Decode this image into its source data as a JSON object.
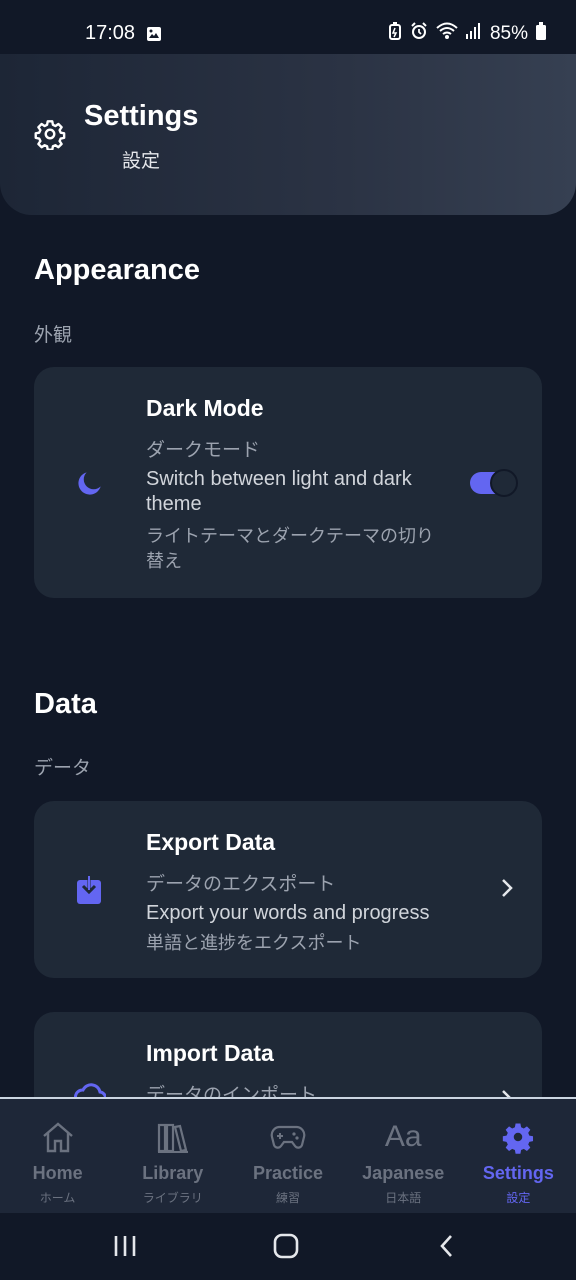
{
  "status_bar": {
    "time": "17:08",
    "battery": "85%"
  },
  "header": {
    "title": "Settings",
    "subtitle": "設定",
    "icon": "gear-icon"
  },
  "sections": {
    "appearance": {
      "title": "Appearance",
      "subtitle": "外観"
    },
    "data": {
      "title": "Data",
      "subtitle": "データ"
    }
  },
  "dark_mode": {
    "icon": "moon-icon",
    "title": "Dark Mode",
    "title_jp": "ダークモード",
    "desc": "Switch between light and dark theme",
    "desc_jp": "ライトテーマとダークテーマの切り替え",
    "enabled": true
  },
  "export": {
    "icon": "download-icon",
    "title": "Export Data",
    "title_jp": "データのエクスポート",
    "desc": "Export your words and progress",
    "desc_jp": "単語と進捗をエクスポート"
  },
  "import": {
    "icon": "upload-icon",
    "title": "Import Data",
    "title_jp": "データのインポート"
  },
  "nav": [
    {
      "label": "Home",
      "label_jp": "ホーム",
      "icon": "home-icon"
    },
    {
      "label": "Library",
      "label_jp": "ライブラリ",
      "icon": "library-icon"
    },
    {
      "label": "Practice",
      "label_jp": "練習",
      "icon": "gamepad-icon"
    },
    {
      "label": "Japanese",
      "label_jp": "日本語",
      "icon": "aa-icon",
      "glyph": "Aa"
    },
    {
      "label": "Settings",
      "label_jp": "設定",
      "icon": "gear-icon",
      "active": true
    }
  ],
  "colors": {
    "accent": "#6366f1",
    "background": "#111827",
    "card": "#1f2937"
  }
}
